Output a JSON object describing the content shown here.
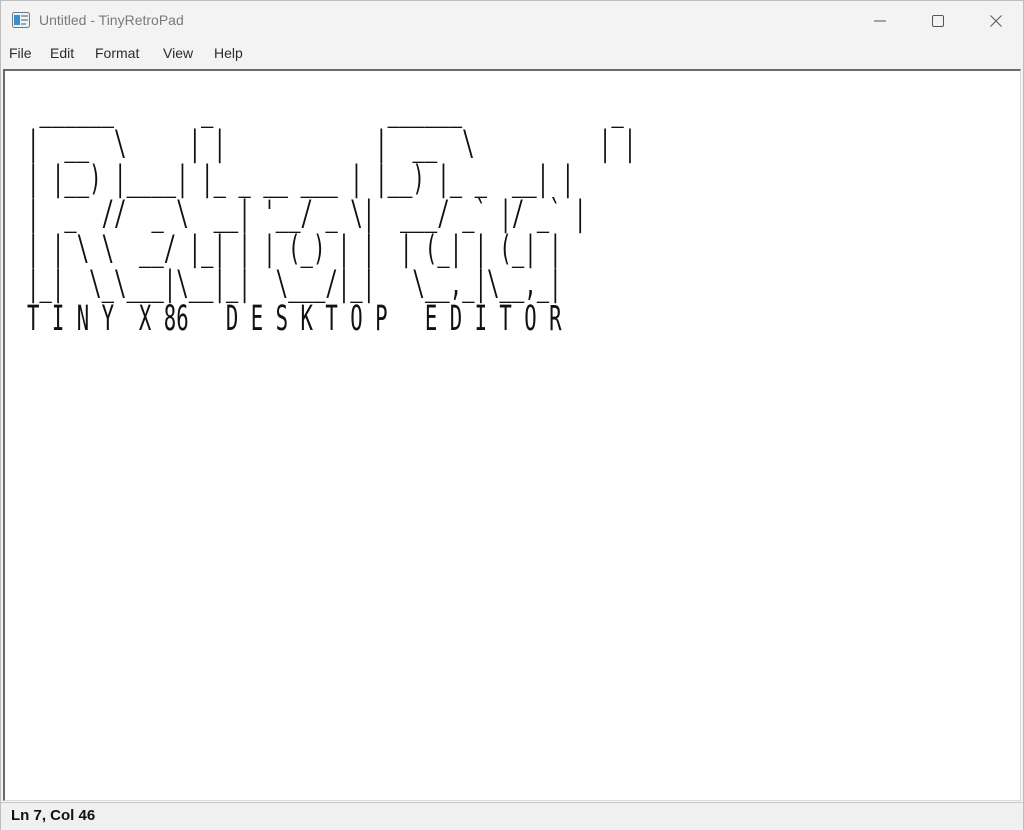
{
  "window": {
    "title": "Untitled - TinyRetroPad",
    "app_icon": "notepad-app-icon",
    "caption_icons": [
      "minimize-icon",
      "maximize-icon",
      "close-icon"
    ]
  },
  "menu": {
    "file": "File",
    "edit": "Edit",
    "format": "Format",
    "view": "View",
    "help": "Help"
  },
  "editor": {
    "lines": [
      " ______       _              ______            _ ",
      "|  __  \\     | |            |  __  \\          | |",
      "| |__) |____| |_ _ __ ___ | |__) |_ _  __| |",
      "|  _  //  _ \\  __| '__/ _ \\|  ___/ _` |/ _` |",
      "| | \\ \\  __/ |_| | | (_) | |  | (_| | (_| |",
      "|_|  \\_\\___|\\__|_|  \\___/|_|   \\__,_|\\__,_|",
      "T I N Y  X 86   D E S K T O P   E D I T O R"
    ]
  },
  "status": {
    "position": "Ln 7, Col 46"
  }
}
